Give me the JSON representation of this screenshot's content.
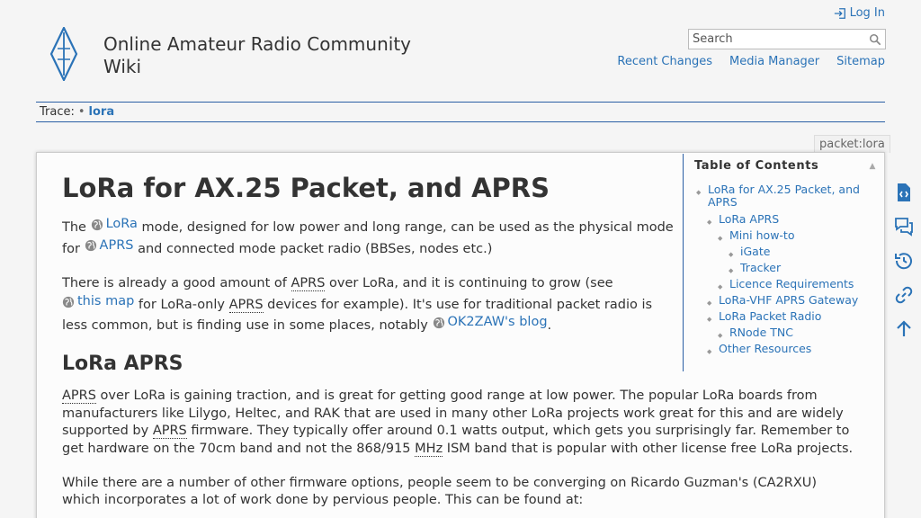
{
  "header": {
    "site_title": "Online Amateur Radio Community Wiki",
    "login_label": "Log In",
    "search_placeholder": "Search",
    "tools": [
      "Recent Changes",
      "Media Manager",
      "Sitemap"
    ]
  },
  "breadcrumb": {
    "prefix": "Trace:",
    "separator": "•",
    "current": "lora"
  },
  "page_id": "packet:lora",
  "article": {
    "title": "LoRa for AX.25 Packet, and APRS",
    "p1": {
      "t1": "The ",
      "link1": "LoRa",
      "t2": " mode, designed for low power and long range, can be used as the physical mode for ",
      "link2": "APRS",
      "t3": " and connected mode packet radio (BBSes, nodes etc.)"
    },
    "p2": {
      "t1": "There is already a good amount of ",
      "abbr1": "APRS",
      "t2": " over LoRa, and it is continuing to grow (see ",
      "link1": "this map",
      "t3": " for LoRa-only ",
      "abbr2": "APRS",
      "t4": " devices for example). It's use for traditional packet radio is less common, but is finding use in some places, notably ",
      "link2": "OK2ZAW's blog",
      "t5": "."
    },
    "h2_lora_aprs": "LoRa APRS",
    "p3": {
      "abbr1": "APRS",
      "t1": " over LoRa is gaining traction, and is great for getting good range at low power. The popular LoRa boards from manufacturers like Lilygo, Heltec, and RAK that are used in many other LoRa projects work great for this and are widely supported by ",
      "abbr2": "APRS",
      "t2": " firmware. They typically offer around 0.1 watts output, which gets you surprisingly far. Remember to get hardware on the 70cm band and not the 868/915 ",
      "abbr3": "MHz",
      "t3": " ISM band that is popular with other license free LoRa projects."
    },
    "p4": "While there are a number of other firmware options, people seem to be converging on Ricardo Guzman's (CA2RXU) which incorporates a lot of work done by pervious people. This can be found at:"
  },
  "toc": {
    "title": "Table of Contents",
    "toggle": "▲",
    "items": [
      {
        "label": "LoRa for AX.25 Packet, and APRS",
        "level": 1
      },
      {
        "label": "LoRa APRS",
        "level": 2
      },
      {
        "label": "Mini how-to",
        "level": 3
      },
      {
        "label": "iGate",
        "level": 4
      },
      {
        "label": "Tracker",
        "level": 4
      },
      {
        "label": "Licence Requirements",
        "level": 3
      },
      {
        "label": "LoRa-VHF APRS Gateway",
        "level": 2
      },
      {
        "label": "LoRa Packet Radio",
        "level": 2
      },
      {
        "label": "RNode TNC",
        "level": 3
      },
      {
        "label": "Other Resources",
        "level": 2
      }
    ]
  },
  "pagetools": [
    "show-source-icon",
    "discussion-icon",
    "old-revisions-icon",
    "backlinks-icon",
    "back-to-top-icon"
  ],
  "colors": {
    "link": "#2b73b7",
    "rule": "#2b5fa5",
    "background": "#f5f5f5",
    "page": "#fcfcfc"
  }
}
